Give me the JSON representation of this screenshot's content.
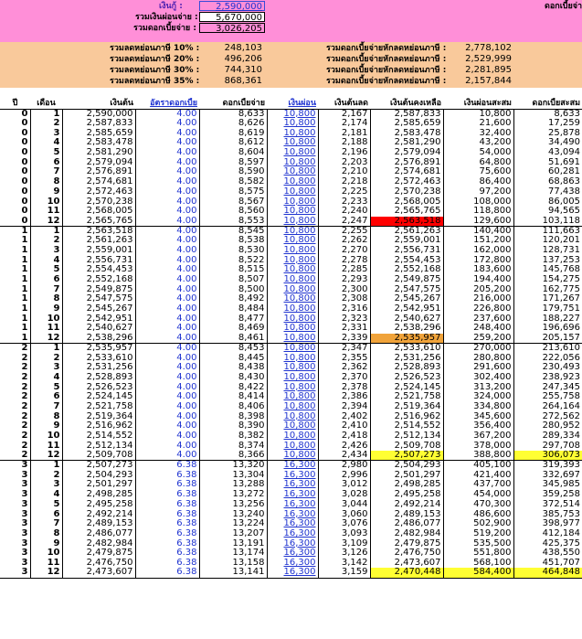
{
  "top": {
    "loan_label": "เงินกู้ :",
    "loan_value": "2,590,000",
    "total_pay_label": "รวมเงินผ่อนจ่าย :",
    "total_pay_value": "5,670,000",
    "total_interest_label": "รวมดอกเบี้ยจ่าย :",
    "total_interest_value": "3,026,205",
    "right_label": "ดอกเบี้ยจ่าย"
  },
  "summary": {
    "left": [
      {
        "label": "รวมลดหย่อนภาษี 10% :",
        "value": "248,103"
      },
      {
        "label": "รวมลดหย่อนภาษี 20% :",
        "value": "496,206"
      },
      {
        "label": "รวมลดหย่อนภาษี 30% :",
        "value": "744,310"
      },
      {
        "label": "รวมลดหย่อนภาษี 35% :",
        "value": "868,361"
      }
    ],
    "right": [
      {
        "label": "รวมดอกเบี้ยจ่ายหักลดหย่อนภาษี :",
        "value": "2,778,102"
      },
      {
        "label": "รวมดอกเบี้ยจ่ายหักลดหย่อนภาษี :",
        "value": "2,529,999"
      },
      {
        "label": "รวมดอกเบี้ยจ่ายหักลดหย่อนภาษี :",
        "value": "2,281,895"
      },
      {
        "label": "รวมดอกเบี้ยจ่ายหักลดหย่อนภาษี :",
        "value": "2,157,844"
      }
    ]
  },
  "table": {
    "headers": [
      "ปี",
      "เดือน",
      "เงินต้น",
      "อัตราดอกเบี้ย",
      "ดอกเบี้ยจ่าย",
      "เงินผ่อน",
      "เงินต้นลด",
      "เงินต้นคงเหลือ",
      "เงินผ่อนสะสม",
      "ดอกเบี้ยสะสม"
    ],
    "rows": [
      [
        "0",
        "1",
        "2,590,000",
        "4.00",
        "8,633",
        "10,800",
        "2,167",
        "2,587,833",
        "10,800",
        "8,633"
      ],
      [
        "0",
        "2",
        "2,587,833",
        "4.00",
        "8,626",
        "10,800",
        "2,174",
        "2,585,659",
        "21,600",
        "17,259"
      ],
      [
        "0",
        "3",
        "2,585,659",
        "4.00",
        "8,619",
        "10,800",
        "2,181",
        "2,583,478",
        "32,400",
        "25,878"
      ],
      [
        "0",
        "4",
        "2,583,478",
        "4.00",
        "8,612",
        "10,800",
        "2,188",
        "2,581,290",
        "43,200",
        "34,490"
      ],
      [
        "0",
        "5",
        "2,581,290",
        "4.00",
        "8,604",
        "10,800",
        "2,196",
        "2,579,094",
        "54,000",
        "43,094"
      ],
      [
        "0",
        "6",
        "2,579,094",
        "4.00",
        "8,597",
        "10,800",
        "2,203",
        "2,576,891",
        "64,800",
        "51,691"
      ],
      [
        "0",
        "7",
        "2,576,891",
        "4.00",
        "8,590",
        "10,800",
        "2,210",
        "2,574,681",
        "75,600",
        "60,281"
      ],
      [
        "0",
        "8",
        "2,574,681",
        "4.00",
        "8,582",
        "10,800",
        "2,218",
        "2,572,463",
        "86,400",
        "68,863"
      ],
      [
        "0",
        "9",
        "2,572,463",
        "4.00",
        "8,575",
        "10,800",
        "2,225",
        "2,570,238",
        "97,200",
        "77,438"
      ],
      [
        "0",
        "10",
        "2,570,238",
        "4.00",
        "8,567",
        "10,800",
        "2,233",
        "2,568,005",
        "108,000",
        "86,005"
      ],
      [
        "0",
        "11",
        "2,568,005",
        "4.00",
        "8,560",
        "10,800",
        "2,240",
        "2,565,765",
        "118,800",
        "94,565"
      ],
      [
        "0",
        "12",
        "2,565,765",
        "4.00",
        "8,553",
        "10,800",
        "2,247",
        "2,563,518",
        "129,600",
        "103,118"
      ],
      [
        "1",
        "1",
        "2,563,518",
        "4.00",
        "8,545",
        "10,800",
        "2,255",
        "2,561,263",
        "140,400",
        "111,663"
      ],
      [
        "1",
        "2",
        "2,561,263",
        "4.00",
        "8,538",
        "10,800",
        "2,262",
        "2,559,001",
        "151,200",
        "120,201"
      ],
      [
        "1",
        "3",
        "2,559,001",
        "4.00",
        "8,530",
        "10,800",
        "2,270",
        "2,556,731",
        "162,000",
        "128,731"
      ],
      [
        "1",
        "4",
        "2,556,731",
        "4.00",
        "8,522",
        "10,800",
        "2,278",
        "2,554,453",
        "172,800",
        "137,253"
      ],
      [
        "1",
        "5",
        "2,554,453",
        "4.00",
        "8,515",
        "10,800",
        "2,285",
        "2,552,168",
        "183,600",
        "145,768"
      ],
      [
        "1",
        "6",
        "2,552,168",
        "4.00",
        "8,507",
        "10,800",
        "2,293",
        "2,549,875",
        "194,400",
        "154,275"
      ],
      [
        "1",
        "7",
        "2,549,875",
        "4.00",
        "8,500",
        "10,800",
        "2,300",
        "2,547,575",
        "205,200",
        "162,775"
      ],
      [
        "1",
        "8",
        "2,547,575",
        "4.00",
        "8,492",
        "10,800",
        "2,308",
        "2,545,267",
        "216,000",
        "171,267"
      ],
      [
        "1",
        "9",
        "2,545,267",
        "4.00",
        "8,484",
        "10,800",
        "2,316",
        "2,542,951",
        "226,800",
        "179,751"
      ],
      [
        "1",
        "10",
        "2,542,951",
        "4.00",
        "8,477",
        "10,800",
        "2,323",
        "2,540,627",
        "237,600",
        "188,227"
      ],
      [
        "1",
        "11",
        "2,540,627",
        "4.00",
        "8,469",
        "10,800",
        "2,331",
        "2,538,296",
        "248,400",
        "196,696"
      ],
      [
        "1",
        "12",
        "2,538,296",
        "4.00",
        "8,461",
        "10,800",
        "2,339",
        "2,535,957",
        "259,200",
        "205,157"
      ],
      [
        "2",
        "1",
        "2,535,957",
        "4.00",
        "8,453",
        "10,800",
        "2,347",
        "2,533,610",
        "270,000",
        "213,610"
      ],
      [
        "2",
        "2",
        "2,533,610",
        "4.00",
        "8,445",
        "10,800",
        "2,355",
        "2,531,256",
        "280,800",
        "222,056"
      ],
      [
        "2",
        "3",
        "2,531,256",
        "4.00",
        "8,438",
        "10,800",
        "2,362",
        "2,528,893",
        "291,600",
        "230,493"
      ],
      [
        "2",
        "4",
        "2,528,893",
        "4.00",
        "8,430",
        "10,800",
        "2,370",
        "2,526,523",
        "302,400",
        "238,923"
      ],
      [
        "2",
        "5",
        "2,526,523",
        "4.00",
        "8,422",
        "10,800",
        "2,378",
        "2,524,145",
        "313,200",
        "247,345"
      ],
      [
        "2",
        "6",
        "2,524,145",
        "4.00",
        "8,414",
        "10,800",
        "2,386",
        "2,521,758",
        "324,000",
        "255,758"
      ],
      [
        "2",
        "7",
        "2,521,758",
        "4.00",
        "8,406",
        "10,800",
        "2,394",
        "2,519,364",
        "334,800",
        "264,164"
      ],
      [
        "2",
        "8",
        "2,519,364",
        "4.00",
        "8,398",
        "10,800",
        "2,402",
        "2,516,962",
        "345,600",
        "272,562"
      ],
      [
        "2",
        "9",
        "2,516,962",
        "4.00",
        "8,390",
        "10,800",
        "2,410",
        "2,514,552",
        "356,400",
        "280,952"
      ],
      [
        "2",
        "10",
        "2,514,552",
        "4.00",
        "8,382",
        "10,800",
        "2,418",
        "2,512,134",
        "367,200",
        "289,334"
      ],
      [
        "2",
        "11",
        "2,512,134",
        "4.00",
        "8,374",
        "10,800",
        "2,426",
        "2,509,708",
        "378,000",
        "297,708"
      ],
      [
        "2",
        "12",
        "2,509,708",
        "4.00",
        "8,366",
        "10,800",
        "2,434",
        "2,507,273",
        "388,800",
        "306,073"
      ],
      [
        "3",
        "1",
        "2,507,273",
        "6.38",
        "13,320",
        "16,300",
        "2,980",
        "2,504,293",
        "405,100",
        "319,393"
      ],
      [
        "3",
        "2",
        "2,504,293",
        "6.38",
        "13,304",
        "16,300",
        "2,996",
        "2,501,297",
        "421,400",
        "332,697"
      ],
      [
        "3",
        "3",
        "2,501,297",
        "6.38",
        "13,288",
        "16,300",
        "3,012",
        "2,498,285",
        "437,700",
        "345,985"
      ],
      [
        "3",
        "4",
        "2,498,285",
        "6.38",
        "13,272",
        "16,300",
        "3,028",
        "2,495,258",
        "454,000",
        "359,258"
      ],
      [
        "3",
        "5",
        "2,495,258",
        "6.38",
        "13,256",
        "16,300",
        "3,044",
        "2,492,214",
        "470,300",
        "372,514"
      ],
      [
        "3",
        "6",
        "2,492,214",
        "6.38",
        "13,240",
        "16,300",
        "3,060",
        "2,489,153",
        "486,600",
        "385,753"
      ],
      [
        "3",
        "7",
        "2,489,153",
        "6.38",
        "13,224",
        "16,300",
        "3,076",
        "2,486,077",
        "502,900",
        "398,977"
      ],
      [
        "3",
        "8",
        "2,486,077",
        "6.38",
        "13,207",
        "16,300",
        "3,093",
        "2,482,984",
        "519,200",
        "412,184"
      ],
      [
        "3",
        "9",
        "2,482,984",
        "6.38",
        "13,191",
        "16,300",
        "3,109",
        "2,479,875",
        "535,500",
        "425,375"
      ],
      [
        "3",
        "10",
        "2,479,875",
        "6.38",
        "13,174",
        "16,300",
        "3,126",
        "2,476,750",
        "551,800",
        "438,550"
      ],
      [
        "3",
        "11",
        "2,476,750",
        "6.38",
        "13,158",
        "16,300",
        "3,142",
        "2,473,607",
        "568,100",
        "451,707"
      ],
      [
        "3",
        "12",
        "2,473,607",
        "6.38",
        "13,141",
        "16,300",
        "3,159",
        "2,470,448",
        "584,400",
        "464,848"
      ]
    ]
  },
  "colors": {
    "header_pink": "#ff8fd8",
    "summary_peach": "#f9c99b",
    "blue_text": "#1f33d0",
    "highlight_red": "#ff0000",
    "highlight_orange": "#f0a33a",
    "highlight_yellow": "#ffff33"
  }
}
